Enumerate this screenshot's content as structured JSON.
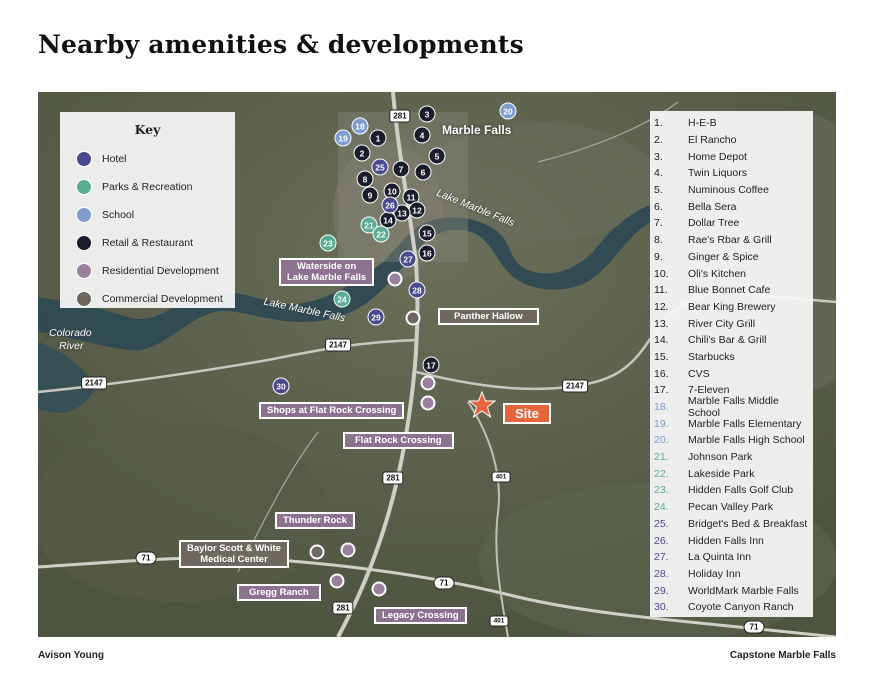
{
  "title": "Nearby amenities & developments",
  "footer": {
    "left": "Avison Young",
    "right": "Capstone Marble Falls"
  },
  "colors": {
    "hotel": "#4a4a8e",
    "parks": "#5aad94",
    "school": "#7f9bd0",
    "retail": "#1a1d2b",
    "residential": "#9b809e",
    "commercial": "#6e6860",
    "site": "#e8643a"
  },
  "key": {
    "title": "Key",
    "items": [
      {
        "label": "Hotel",
        "color": "#4a4a8e"
      },
      {
        "label": "Parks & Recreation",
        "color": "#5aad94"
      },
      {
        "label": "School",
        "color": "#7f9bd0"
      },
      {
        "label": "Retail & Restaurant",
        "color": "#1a1d2b"
      },
      {
        "label": "Residential Development",
        "color": "#9b809e"
      },
      {
        "label": "Commercial Development",
        "color": "#6e6860"
      }
    ]
  },
  "amenities": [
    {
      "num": "1.",
      "name": "H-E-B",
      "cat": "retail"
    },
    {
      "num": "2.",
      "name": "El Rancho",
      "cat": "retail"
    },
    {
      "num": "3.",
      "name": "Home Depot",
      "cat": "retail"
    },
    {
      "num": "4.",
      "name": "Twin Liquors",
      "cat": "retail"
    },
    {
      "num": "5.",
      "name": "Numinous Coffee",
      "cat": "retail"
    },
    {
      "num": "6.",
      "name": "Bella Sera",
      "cat": "retail"
    },
    {
      "num": "7.",
      "name": "Dollar Tree",
      "cat": "retail"
    },
    {
      "num": "8.",
      "name": "Rae's Rbar & Grill",
      "cat": "retail"
    },
    {
      "num": "9.",
      "name": "Ginger & Spice",
      "cat": "retail"
    },
    {
      "num": "10.",
      "name": "Oli's Kitchen",
      "cat": "retail"
    },
    {
      "num": "11.",
      "name": "Blue Bonnet Cafe",
      "cat": "retail"
    },
    {
      "num": "12.",
      "name": "Bear King Brewery",
      "cat": "retail"
    },
    {
      "num": "13.",
      "name": "River City Grill",
      "cat": "retail"
    },
    {
      "num": "14.",
      "name": "Chili's Bar & Grill",
      "cat": "retail"
    },
    {
      "num": "15.",
      "name": "Starbucks",
      "cat": "retail"
    },
    {
      "num": "16.",
      "name": "CVS",
      "cat": "retail"
    },
    {
      "num": "17.",
      "name": "7-Eleven",
      "cat": "retail"
    },
    {
      "num": "18.",
      "name": "Marble Falls Middle School",
      "cat": "school"
    },
    {
      "num": "19.",
      "name": "Marble Falls Elementary",
      "cat": "school"
    },
    {
      "num": "20.",
      "name": "Marble Falls High School",
      "cat": "school"
    },
    {
      "num": "21.",
      "name": "Johnson Park",
      "cat": "parks"
    },
    {
      "num": "22.",
      "name": "Lakeside Park",
      "cat": "parks"
    },
    {
      "num": "23.",
      "name": "Hidden Falls Golf Club",
      "cat": "parks"
    },
    {
      "num": "24.",
      "name": "Pecan Valley Park",
      "cat": "parks"
    },
    {
      "num": "25.",
      "name": "Bridget's Bed & Breakfast",
      "cat": "hotel"
    },
    {
      "num": "26.",
      "name": "Hidden Falls Inn",
      "cat": "hotel"
    },
    {
      "num": "27.",
      "name": "La Quinta Inn",
      "cat": "hotel"
    },
    {
      "num": "28.",
      "name": "Holiday Inn",
      "cat": "hotel"
    },
    {
      "num": "29.",
      "name": "WorldMark Marble Falls",
      "cat": "hotel"
    },
    {
      "num": "30.",
      "name": "Coyote Canyon Ranch",
      "cat": "hotel"
    }
  ],
  "map": {
    "place_names": {
      "city": "Marble Falls",
      "lake_upper": "Lake Marble Falls",
      "lake_lower": "Lake Marble Falls",
      "river_line1": "Colorado",
      "river_line2": "River"
    },
    "markers": [
      {
        "n": "1",
        "cat": "retail"
      },
      {
        "n": "2",
        "cat": "retail"
      },
      {
        "n": "3",
        "cat": "retail"
      },
      {
        "n": "4",
        "cat": "retail"
      },
      {
        "n": "5",
        "cat": "retail"
      },
      {
        "n": "6",
        "cat": "retail"
      },
      {
        "n": "7",
        "cat": "retail"
      },
      {
        "n": "8",
        "cat": "retail"
      },
      {
        "n": "9",
        "cat": "retail"
      },
      {
        "n": "10",
        "cat": "retail"
      },
      {
        "n": "11",
        "cat": "retail"
      },
      {
        "n": "12",
        "cat": "retail"
      },
      {
        "n": "13",
        "cat": "retail"
      },
      {
        "n": "14",
        "cat": "retail"
      },
      {
        "n": "15",
        "cat": "retail"
      },
      {
        "n": "16",
        "cat": "retail"
      },
      {
        "n": "17",
        "cat": "retail"
      },
      {
        "n": "18",
        "cat": "school"
      },
      {
        "n": "19",
        "cat": "school"
      },
      {
        "n": "20",
        "cat": "school"
      },
      {
        "n": "21",
        "cat": "parks"
      },
      {
        "n": "22",
        "cat": "parks"
      },
      {
        "n": "23",
        "cat": "parks"
      },
      {
        "n": "24",
        "cat": "parks"
      },
      {
        "n": "25",
        "cat": "hotel"
      },
      {
        "n": "26",
        "cat": "hotel"
      },
      {
        "n": "27",
        "cat": "hotel"
      },
      {
        "n": "28",
        "cat": "hotel"
      },
      {
        "n": "29",
        "cat": "hotel"
      },
      {
        "n": "30",
        "cat": "hotel"
      }
    ],
    "developments": {
      "waterside_line1": "Waterside on",
      "waterside_line2": "Lake Marble Falls",
      "panther": "Panther Hallow",
      "shops": "Shops at Flat Rock Crossing",
      "flat_rock": "Flat Rock Crossing",
      "thunder": "Thunder Rock",
      "baylor_line1": "Baylor Scott & White",
      "baylor_line2": "Medical Center",
      "gregg": "Gregg Ranch",
      "legacy": "Legacy Crossing"
    },
    "site_label": "Site",
    "roads": {
      "r281": "281",
      "r2147": "2147",
      "r71": "71",
      "r401": "401"
    }
  }
}
